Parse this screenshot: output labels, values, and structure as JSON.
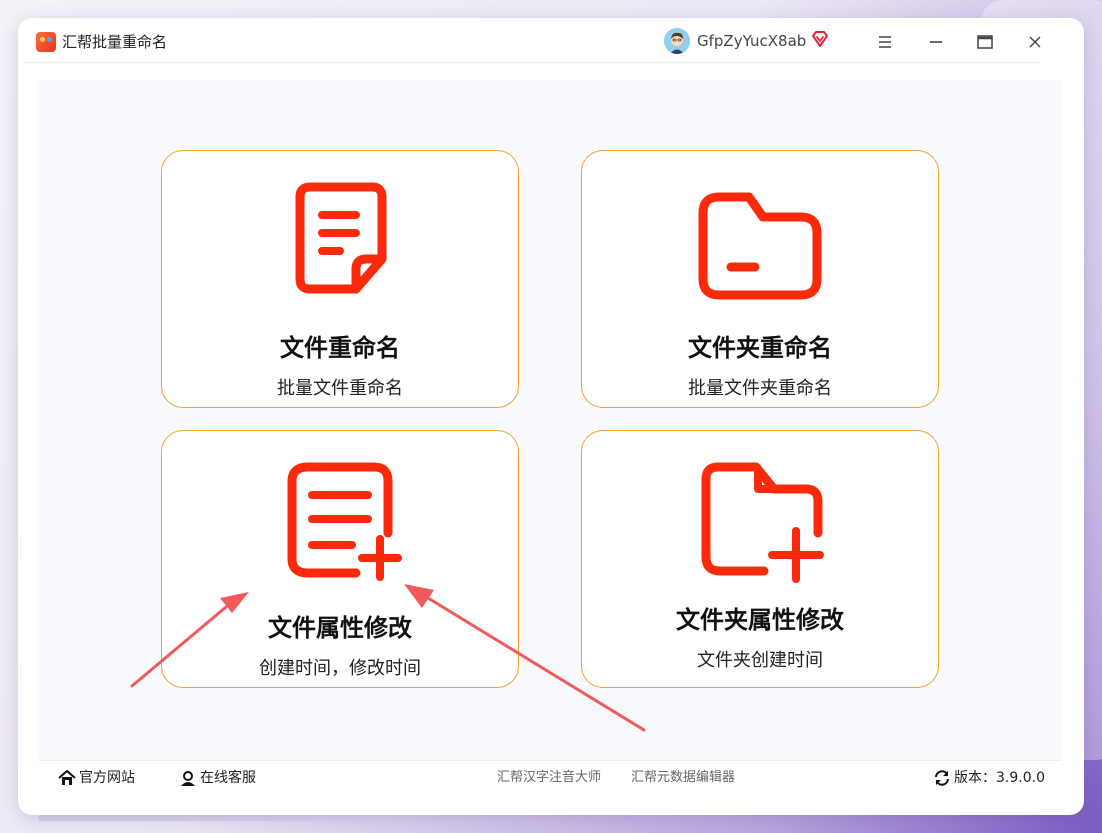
{
  "window": {
    "app_title": "汇帮批量重命名",
    "username": "GfpZyYucX8ab",
    "icons": [
      "app-logo",
      "avatar",
      "vip-diamond-icon",
      "menu-icon",
      "minimize-icon",
      "maximize-icon",
      "close-icon"
    ]
  },
  "cards": [
    {
      "id": "file-rename",
      "title": "文件重命名",
      "subtitle": "批量文件重命名",
      "icon": "document-icon"
    },
    {
      "id": "folder-rename",
      "title": "文件夹重命名",
      "subtitle": "批量文件夹重命名",
      "icon": "folder-icon"
    },
    {
      "id": "file-attr",
      "title": "文件属性修改",
      "subtitle": "创建时间，修改时间",
      "icon": "document-add-icon"
    },
    {
      "id": "folder-attr",
      "title": "文件夹属性修改",
      "subtitle": "文件夹创建时间",
      "icon": "folder-add-icon"
    }
  ],
  "footer": {
    "website": "官方网站",
    "support": "在线客服",
    "link1": "汇帮汉字注音大师",
    "link2": "汇帮元数据编辑器",
    "version_label": "版本：",
    "version_value": "3.9.0.0"
  },
  "colors": {
    "accent_icon": "#fa2a0a",
    "card_border": "#f5a030",
    "arrow": "#f05a5a"
  }
}
